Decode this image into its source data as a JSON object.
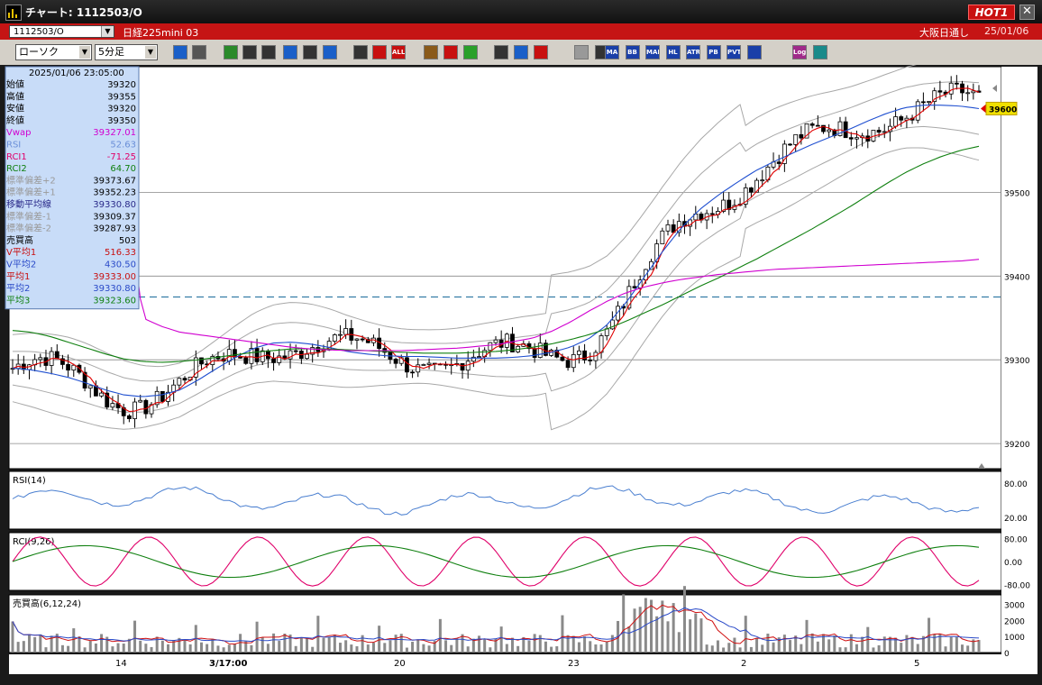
{
  "window": {
    "title": "チャート: 1112503/O",
    "hot_label": "HOT1",
    "close_glyph": "✕"
  },
  "info_bar": {
    "symbol": "1112503/O",
    "market": "日経225mini 03",
    "session": "大阪日通し",
    "date": "25/01/06"
  },
  "toolbar": {
    "chart_type": "ローソク",
    "timeframe": "5分足",
    "buttons": [
      {
        "icon": "zoom-icon",
        "label": "",
        "color": "#1a5fc8"
      },
      {
        "icon": "crosshair-icon",
        "label": "",
        "color": "#555555"
      },
      {
        "icon": "pencil-icon",
        "label": "",
        "color": "#2a8a2a"
      },
      {
        "icon": "line-tool-icon",
        "label": "",
        "color": "#333333"
      },
      {
        "icon": "cursor-icon",
        "label": "",
        "color": "#333333"
      },
      {
        "icon": "undo-icon",
        "label": "",
        "color": "#1a5fc8"
      },
      {
        "icon": "note-icon",
        "label": "",
        "color": "#333333"
      },
      {
        "icon": "trash-icon",
        "label": "",
        "color": "#1a5fc8"
      },
      {
        "icon": "candle-icon",
        "label": "",
        "color": "#333333"
      },
      {
        "icon": "candle-red-icon",
        "label": "",
        "color": "#c81010"
      },
      {
        "icon": "all-icon",
        "label": "ALL",
        "color": "#c81010"
      },
      {
        "icon": "gear-icon",
        "label": "",
        "color": "#8a5a1a"
      },
      {
        "icon": "wrench-icon",
        "label": "",
        "color": "#c81010"
      },
      {
        "icon": "palette-icon",
        "label": "",
        "color": "#2aa02a"
      },
      {
        "icon": "download-icon",
        "label": "",
        "color": "#333333"
      },
      {
        "icon": "search-icon",
        "label": "",
        "color": "#1a5fc8"
      },
      {
        "icon": "flag-icon",
        "label": "",
        "color": "#c81010"
      },
      {
        "icon": "info-icon",
        "label": "",
        "color": "#999999"
      },
      {
        "icon": "rule-icon",
        "label": "",
        "color": "#333333"
      },
      {
        "icon": "ma-icon",
        "label": "MA",
        "color": "#1a3fa8"
      },
      {
        "icon": "bb-icon",
        "label": "BB",
        "color": "#1a3fa8"
      },
      {
        "icon": "mae-icon",
        "label": "MAE",
        "color": "#1a3fa8"
      },
      {
        "icon": "hl-icon",
        "label": "HL",
        "color": "#1a3fa8"
      },
      {
        "icon": "atr-icon",
        "label": "ATR",
        "color": "#1a3fa8"
      },
      {
        "icon": "pb-icon",
        "label": "PB",
        "color": "#1a3fa8"
      },
      {
        "icon": "pvt-icon",
        "label": "PVT",
        "color": "#1a3fa8"
      },
      {
        "icon": "box-icon",
        "label": "",
        "color": "#1a3fa8"
      },
      {
        "icon": "log-icon",
        "label": "Log",
        "color": "#a02a8a"
      },
      {
        "icon": "export-icon",
        "label": "",
        "color": "#1a8a8a"
      }
    ]
  },
  "data_window": {
    "datetime": "2025/01/06  23:05:00",
    "rows": [
      {
        "label": "始値",
        "value": "39320",
        "color": "#000000"
      },
      {
        "label": "高値",
        "value": "39355",
        "color": "#000000"
      },
      {
        "label": "安値",
        "value": "39320",
        "color": "#000000"
      },
      {
        "label": "終値",
        "value": "39350",
        "color": "#000000"
      },
      {
        "label": "Vwap",
        "value": "39327.01",
        "color": "#d000d0"
      },
      {
        "label": "RSI",
        "value": "52.63",
        "color": "#6a8fd8"
      },
      {
        "label": "RCI1",
        "value": "-71.25",
        "color": "#e0006a"
      },
      {
        "label": "RCI2",
        "value": "64.70",
        "color": "#108010"
      },
      {
        "label": "標準偏差+2",
        "value": "39373.67",
        "color": "#9a9a9a"
      },
      {
        "label": "標準偏差+1",
        "value": "39352.23",
        "color": "#9a9a9a"
      },
      {
        "label": "移動平均線",
        "value": "39330.80",
        "color": "#2a2a8a"
      },
      {
        "label": "標準偏差-1",
        "value": "39309.37",
        "color": "#9a9a9a"
      },
      {
        "label": "標準偏差-2",
        "value": "39287.93",
        "color": "#9a9a9a"
      },
      {
        "label": "売買高",
        "value": "503",
        "color": "#000000"
      },
      {
        "label": "V平均1",
        "value": "516.33",
        "color": "#c81010"
      },
      {
        "label": "V平均2",
        "value": "430.50",
        "color": "#2a4ac8"
      },
      {
        "label": "平均1",
        "value": "39333.00",
        "color": "#c81010"
      },
      {
        "label": "平均2",
        "value": "39330.80",
        "color": "#2a4ac8"
      },
      {
        "label": "平均3",
        "value": "39323.60",
        "color": "#108010"
      }
    ]
  },
  "panels": {
    "rsi_label": "RSI(14)",
    "rci_label": "RCI(9,26)",
    "volume_label": "売買高(6,12,24)"
  },
  "current_price": "39600",
  "chart_data": [
    {
      "type": "candlestick",
      "price_ticks": [
        "39500",
        "39400",
        "39300",
        "39200"
      ],
      "x_ticks": [
        "14",
        "3/17:00",
        "20",
        "23",
        "2",
        "5"
      ],
      "ylim": [
        39170,
        39650
      ],
      "series": [
        {
          "name": "移動平均線",
          "values": [
            39290,
            39288,
            39284,
            39279,
            39272,
            39264,
            39258,
            39256,
            39258,
            39264,
            39276,
            39290,
            39303,
            39314,
            39320,
            39321,
            39319,
            39315,
            39310,
            39307,
            39305,
            39304,
            39304,
            39303,
            39302,
            39302,
            39302,
            39303,
            39305,
            39309,
            39315,
            39325,
            39342,
            39368,
            39399,
            39430,
            39458,
            39480,
            39497,
            39512,
            39526,
            39537,
            39547,
            39557,
            39566,
            39575,
            39585,
            39594,
            39601,
            39604,
            39604,
            39603,
            39600
          ]
        },
        {
          "name": "平均3",
          "values": [
            39335,
            39333,
            39328,
            39321,
            39314,
            39307,
            39301,
            39298,
            39297,
            39298,
            39300,
            39303,
            39306,
            39309,
            39311,
            39313,
            39313,
            39313,
            39312,
            39311,
            39310,
            39309,
            39308,
            39308,
            39308,
            39309,
            39310,
            39312,
            39315,
            39319,
            39324,
            39330,
            39337,
            39346,
            39356,
            39366,
            39377,
            39388,
            39398,
            39409,
            39420,
            39432,
            39444,
            39456,
            39469,
            39482,
            39496,
            39510,
            39523,
            39534,
            39543,
            39550,
            39555
          ]
        },
        {
          "name": "Vwap",
          "values": [
            39540,
            39538,
            39537,
            39535,
            39534,
            39533,
            39531,
            39350,
            39340,
            39333,
            39330,
            39327,
            39324,
            39321,
            39318,
            39315,
            39313,
            39312,
            39311,
            39311,
            39311,
            39311,
            39312,
            39313,
            39314,
            39316,
            39318,
            39322,
            39326,
            39334,
            39345,
            39358,
            39370,
            39380,
            39387,
            39392,
            39396,
            39399,
            39402,
            39404,
            39406,
            39408,
            39409,
            39410,
            39411,
            39412,
            39413,
            39414,
            39415,
            39416,
            39417,
            39418,
            39420
          ]
        }
      ],
      "rsi_ylim": [
        0,
        100
      ],
      "rsi_ticks": [
        "80.00",
        "20.00"
      ],
      "rci_ylim": [
        -100,
        100
      ],
      "rci_ticks": [
        "80.00",
        "0.00",
        "-80.00"
      ],
      "volume_ticks": [
        "3000",
        "2000",
        "1000",
        "0"
      ]
    }
  ]
}
